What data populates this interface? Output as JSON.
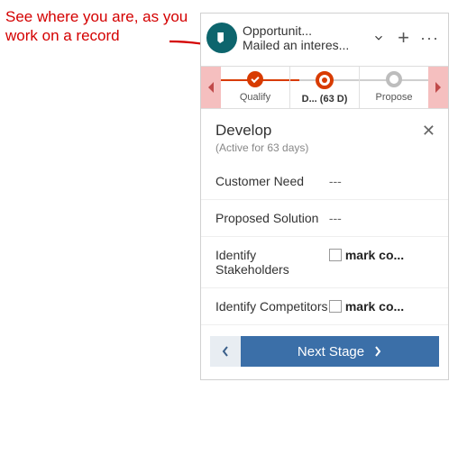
{
  "annotation": "See where you are, as you work on a record",
  "header": {
    "title": "Opportunit...",
    "subtitle": "Mailed an interes..."
  },
  "stages": {
    "items": [
      {
        "label": "Qualify",
        "state": "done"
      },
      {
        "label": "D...  (63 D)",
        "state": "current"
      },
      {
        "label": "Propose",
        "state": "future"
      }
    ]
  },
  "detail": {
    "title": "Develop",
    "subtitle": "(Active for 63 days)"
  },
  "fields": [
    {
      "label": "Customer Need",
      "value": "---",
      "type": "text"
    },
    {
      "label": "Proposed Solution",
      "value": "---",
      "type": "text"
    },
    {
      "label": "Identify Stakeholders",
      "checkbox_label": "mark co...",
      "type": "check"
    },
    {
      "label": "Identify Competitors",
      "checkbox_label": "mark co...",
      "type": "check"
    }
  ],
  "footer": {
    "next_label": "Next Stage"
  }
}
